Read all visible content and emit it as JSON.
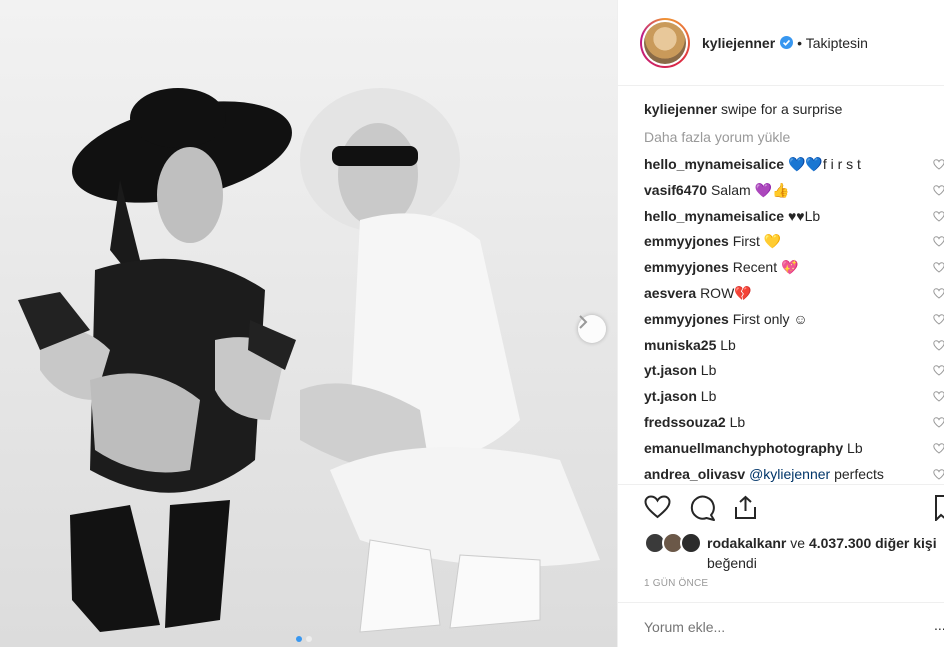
{
  "post": {
    "carousel": {
      "slide_count": 2,
      "current_slide": 1
    }
  },
  "header": {
    "username": "kyliejenner",
    "follow_label": "• Takiptesin"
  },
  "caption": {
    "username": "kyliejenner",
    "text": "swipe for a surprise"
  },
  "load_more_label": "Daha fazla yorum yükle",
  "comments": [
    {
      "user": "hello_mynameisalice",
      "text": "💙💙f i r s t"
    },
    {
      "user": "vasif6470",
      "text": "Salam 💜👍"
    },
    {
      "user": "hello_mynameisalice",
      "text": "♥♥Lb"
    },
    {
      "user": "emmyyjones",
      "text": "First 💛"
    },
    {
      "user": "emmyyjones",
      "text": "Recent 💖"
    },
    {
      "user": "aesvera",
      "text": "ROW💔"
    },
    {
      "user": "emmyyjones",
      "text": "First only ☺"
    },
    {
      "user": "muniska25",
      "text": "Lb"
    },
    {
      "user": "yt.jason",
      "text": "Lb"
    },
    {
      "user": "yt.jason",
      "text": "Lb"
    },
    {
      "user": "fredssouza2",
      "text": "Lb"
    },
    {
      "user": "emanuellmanchyphotography",
      "text": "Lb"
    },
    {
      "user": "andrea_olivasv",
      "mention": "@kyliejenner",
      "text": "perfects"
    }
  ],
  "likes": {
    "first_user": "rodakalkanr",
    "connector": "ve",
    "count": "4.037.300 diğer kişi",
    "suffix": "beğendi"
  },
  "timestamp": "1 GÜN ÖNCE",
  "add_comment": {
    "placeholder": "Yorum ekle..."
  },
  "more_label": "...",
  "colors": {
    "verified": "#3897f0",
    "mention": "#003569",
    "muted": "#999999"
  }
}
